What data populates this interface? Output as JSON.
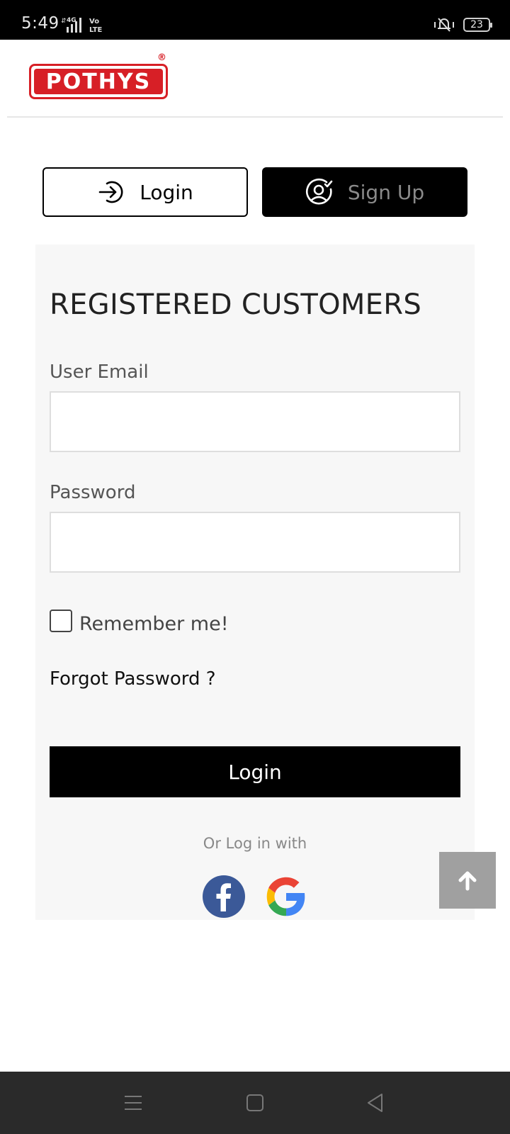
{
  "status_bar": {
    "time": "5:49",
    "network": "4G",
    "volte": "Vo LTE",
    "battery": "23"
  },
  "header": {
    "logo_text": "POTHYS",
    "logo_reg": "®",
    "brand_color": "#d71f26"
  },
  "tabs": {
    "login_label": "Login",
    "signup_label": "Sign Up"
  },
  "form": {
    "title": "REGISTERED CUSTOMERS",
    "email_label": "User Email",
    "email_value": "",
    "password_label": "Password",
    "password_value": "",
    "remember_label": "Remember me!",
    "remember_checked": false,
    "forgot_label": "Forgot Password ?",
    "login_button": "Login",
    "or_text": "Or Log in with"
  },
  "social": {
    "facebook_icon": "facebook-icon",
    "google_icon": "google-icon"
  },
  "scroll_top_icon": "arrow-up-icon",
  "nav": {
    "menu_icon": "menu-icon",
    "home_icon": "home-square-icon",
    "back_icon": "back-triangle-icon"
  }
}
